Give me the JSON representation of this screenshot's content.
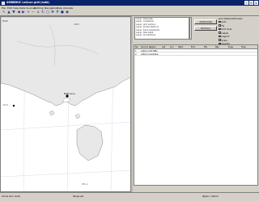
{
  "window": {
    "title": "AMBBDHC Lat/Lon grid (mdd)",
    "controls": [
      "_",
      "□",
      "×"
    ]
  },
  "menu": [
    "File",
    "Edit",
    "View",
    "Data Sources",
    "Plotting",
    "Navigation",
    "Help",
    "Allocate"
  ],
  "toolbar": [
    {
      "name": "pointer-tool-icon",
      "glyph": "↖"
    },
    {
      "name": "nav-up-icon",
      "glyph": "▲"
    },
    {
      "name": "nav-down-icon",
      "glyph": "▼"
    },
    {
      "name": "nav-left-icon",
      "glyph": "◀"
    },
    {
      "name": "nav-right-icon",
      "glyph": "▶"
    },
    {
      "name": "zoom-in-icon",
      "glyph": "+"
    },
    {
      "name": "zoom-out-icon",
      "glyph": "−"
    },
    {
      "name": "home-icon",
      "glyph": "⌂"
    },
    {
      "name": "refresh-icon",
      "glyph": "↻"
    },
    {
      "name": "select-icon",
      "glyph": "◻"
    },
    {
      "name": "pan-icon",
      "glyph": "✥"
    },
    {
      "name": "grid-icon",
      "glyph": "#"
    },
    {
      "name": "stop-icon",
      "glyph": "●"
    },
    {
      "name": "record-icon",
      "glyph": "◉"
    }
  ],
  "map": {
    "labels": {
      "top_left": "BASE",
      "top_right": "-40.0",
      "city": "Melbourne",
      "left_mid": "-37.0",
      "bottom_right": "CTL-1"
    },
    "land_color": "#e8e8e8",
    "coast_color": "#8a8a8a",
    "grid_color": "#c8d4e4"
  },
  "layers": {
    "items": [
      "Layer: basemap",
      "Layer: coastlines",
      "Layer: grid Lat/Lon",
      "Layer: points stations",
      "Layer: track segments",
      "Layer: tiles base",
      "Layer: annotations"
    ]
  },
  "buttons": {
    "add": "Add/Config",
    "remove": "Remove"
  },
  "options": {
    "heading": "Grid Options/Preview",
    "items": [
      "Auto",
      "Fill",
      "Grid lines",
      "Labels",
      "Legend",
      "Scale",
      "Overlay"
    ]
  },
  "table": {
    "headers": [
      "No.",
      "Source",
      "Region",
      "Lat",
      "Lon",
      "Start",
      "End",
      "Pts",
      "Res",
      "Type",
      "Flag"
    ],
    "rows": [
      [
        "1",
        "Lat/Lon",
        "VIC-MEL",
        "",
        "",
        "",
        "",
        "",
        "",
        "",
        ""
      ],
      [
        "2",
        "Lat/Lon",
        "Australia",
        "",
        "",
        "",
        "",
        "",
        "",
        "",
        ""
      ]
    ]
  },
  "status": {
    "left": "Cache size: ready",
    "mid": "Range set",
    "right": "Region: Lat/Lon"
  }
}
